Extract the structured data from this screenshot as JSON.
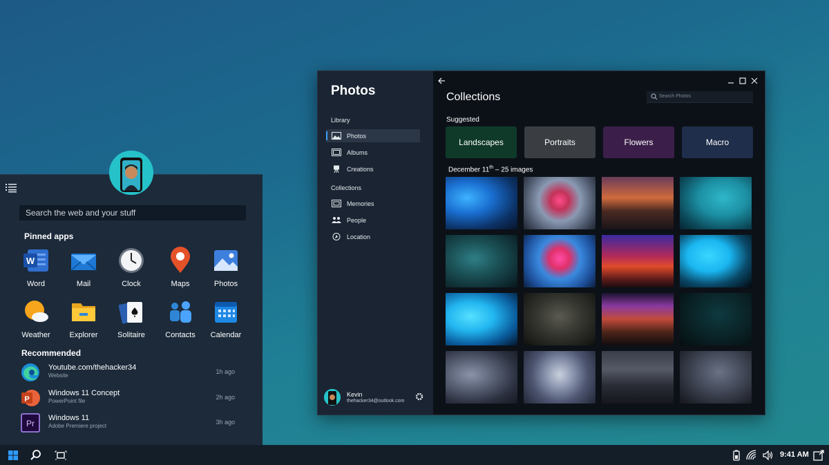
{
  "start_menu": {
    "search_placeholder": "Search the web and your stuff",
    "pinned_title": "Pinned apps",
    "pinned": [
      {
        "label": "Word",
        "icon": "word-icon"
      },
      {
        "label": "Mail",
        "icon": "mail-icon"
      },
      {
        "label": "Clock",
        "icon": "clock-icon"
      },
      {
        "label": "Maps",
        "icon": "maps-icon"
      },
      {
        "label": "Photos",
        "icon": "photos-icon"
      },
      {
        "label": "Weather",
        "icon": "weather-icon"
      },
      {
        "label": "Explorer",
        "icon": "folder-icon"
      },
      {
        "label": "Solitaire",
        "icon": "cards-icon"
      },
      {
        "label": "Contacts",
        "icon": "contacts-icon"
      },
      {
        "label": "Calendar",
        "icon": "calendar-icon"
      }
    ],
    "recommended_title": "Recommended",
    "recommended": [
      {
        "title": "Youtube.com/thehacker34",
        "subtitle": "Website",
        "time": "1h ago",
        "icon": "edge-icon"
      },
      {
        "title": "Windows 11 Concept",
        "subtitle": "PowerPoint file",
        "time": "2h ago",
        "icon": "powerpoint-icon"
      },
      {
        "title": "Windows 11",
        "subtitle": "Adobe Premiere project",
        "time": "3h ago",
        "icon": "premiere-icon"
      }
    ]
  },
  "taskbar": {
    "clock": "9:41 AM"
  },
  "photos": {
    "app_title": "Photos",
    "nav": {
      "library_heading": "Library",
      "library_items": [
        "Photos",
        "Albums",
        "Creations"
      ],
      "collections_heading": "Collections",
      "collections_items": [
        "Memories",
        "People",
        "Location"
      ]
    },
    "user": {
      "name": "Kevin",
      "email": "thehacker34@outlook.com"
    },
    "page_title": "Collections",
    "search_placeholder": "Search Photos",
    "suggested_title": "Suggested",
    "chips": [
      "Landscapes",
      "Portraits",
      "Flowers",
      "Macro"
    ],
    "date_prefix": "December 11",
    "date_sup": "th",
    "date_suffix": " – 25 images"
  },
  "colors": {
    "accent": "#3ea0ff",
    "chip_landscapes": "#0f3a2a",
    "chip_portraits": "#3a3d42",
    "chip_flowers": "#3b1f4a",
    "chip_macro": "#1f2e4a"
  }
}
